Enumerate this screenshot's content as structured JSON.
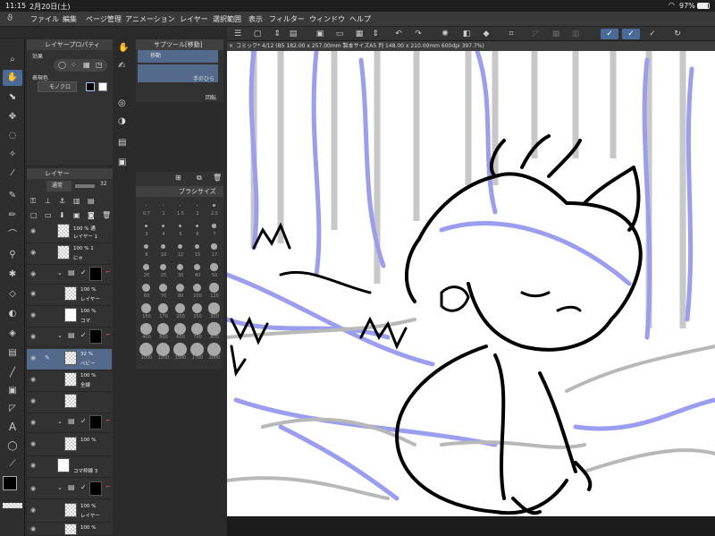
{
  "status": {
    "time": "11:15",
    "date": "2月20日(土)",
    "battery": "97%"
  },
  "menu": [
    "ファイル",
    "編集",
    "ページ管理",
    "アニメーション",
    "レイヤー",
    "選択範囲",
    "表示",
    "フィルター",
    "ウィンドウ",
    "ヘルプ"
  ],
  "layerprop": {
    "title": "レイヤープロパティ",
    "effect": "効果",
    "color_label": "表現色",
    "color_value": "モノクロ"
  },
  "subtool": {
    "title": "サブツール[移動]",
    "item1": "移動",
    "item2": "手のひら",
    "item3": "回転"
  },
  "layer_panel": {
    "title": "レイヤー",
    "blend": "通常",
    "opacity": "32",
    "rows": [
      {
        "pct": "100 % 通",
        "name": "レイヤー 1"
      },
      {
        "pct": "100 % 1",
        "name": "にゃ"
      },
      {
        "pct": "100 %",
        "name": "レイヤー"
      },
      {
        "pct": "100 %",
        "name": "コマ"
      },
      {
        "pct": "32 %",
        "name": "ベビー"
      },
      {
        "pct": "100 %",
        "name": "全線"
      },
      {
        "pct": "100 %",
        "name": "レイヤー"
      },
      {
        "pct": "100 %",
        "name": "コマ枠線 3"
      },
      {
        "pct": "100 %",
        "name": "レイヤー"
      },
      {
        "pct": "100 %",
        "name": "レイヤー"
      }
    ]
  },
  "brushsize": {
    "title": "ブラシサイズ",
    "labels": [
      "0.7",
      "1",
      "1.5",
      "2",
      "2.5",
      "3",
      "4",
      "5",
      "6",
      "7",
      "8",
      "10",
      "12",
      "15",
      "17",
      "20",
      "25",
      "30",
      "40",
      "50",
      "60",
      "70",
      "80",
      "100",
      "120",
      "150",
      "170",
      "200",
      "250",
      "300",
      "400",
      "500",
      "600",
      "700",
      "800",
      "1000",
      "1200",
      "1500",
      "1700",
      "2000"
    ]
  },
  "canvas_title": "コミック* 4/12 (B5 182.00 x 257.00mm 製本サイズA5 判 148.00 x 210.00mm 600dpi 397.7%)",
  "colors": {
    "main": "#000000",
    "sub": "#e0337a",
    "accent": "#4a6a98"
  }
}
